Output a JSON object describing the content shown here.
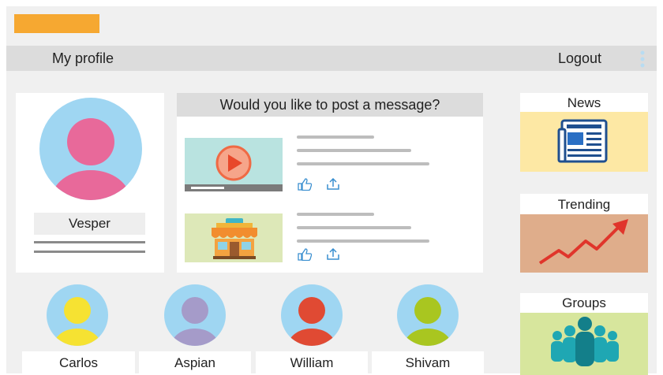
{
  "navbar": {
    "profile_link": "My profile",
    "logout_link": "Logout"
  },
  "profile": {
    "name": "Vesper"
  },
  "composer": {
    "prompt": "Would you like to post a message?"
  },
  "widgets": {
    "news": "News",
    "trending": "Trending",
    "groups": "Groups"
  },
  "friends": [
    {
      "name": "Carlos"
    },
    {
      "name": "Aspian"
    },
    {
      "name": "William"
    },
    {
      "name": "Shivam"
    }
  ],
  "colors": {
    "logo": "#f6a831",
    "avatar_bg": "#9fd6f2",
    "news_bg": "#fde8a4",
    "trending_bg": "#dfad8b",
    "groups_bg": "#d7e69d"
  },
  "icons": [
    "menu-dots-icon",
    "play-icon",
    "like-icon",
    "share-icon",
    "newspaper-icon",
    "trend-arrow-icon",
    "group-people-icon",
    "shop-icon"
  ]
}
